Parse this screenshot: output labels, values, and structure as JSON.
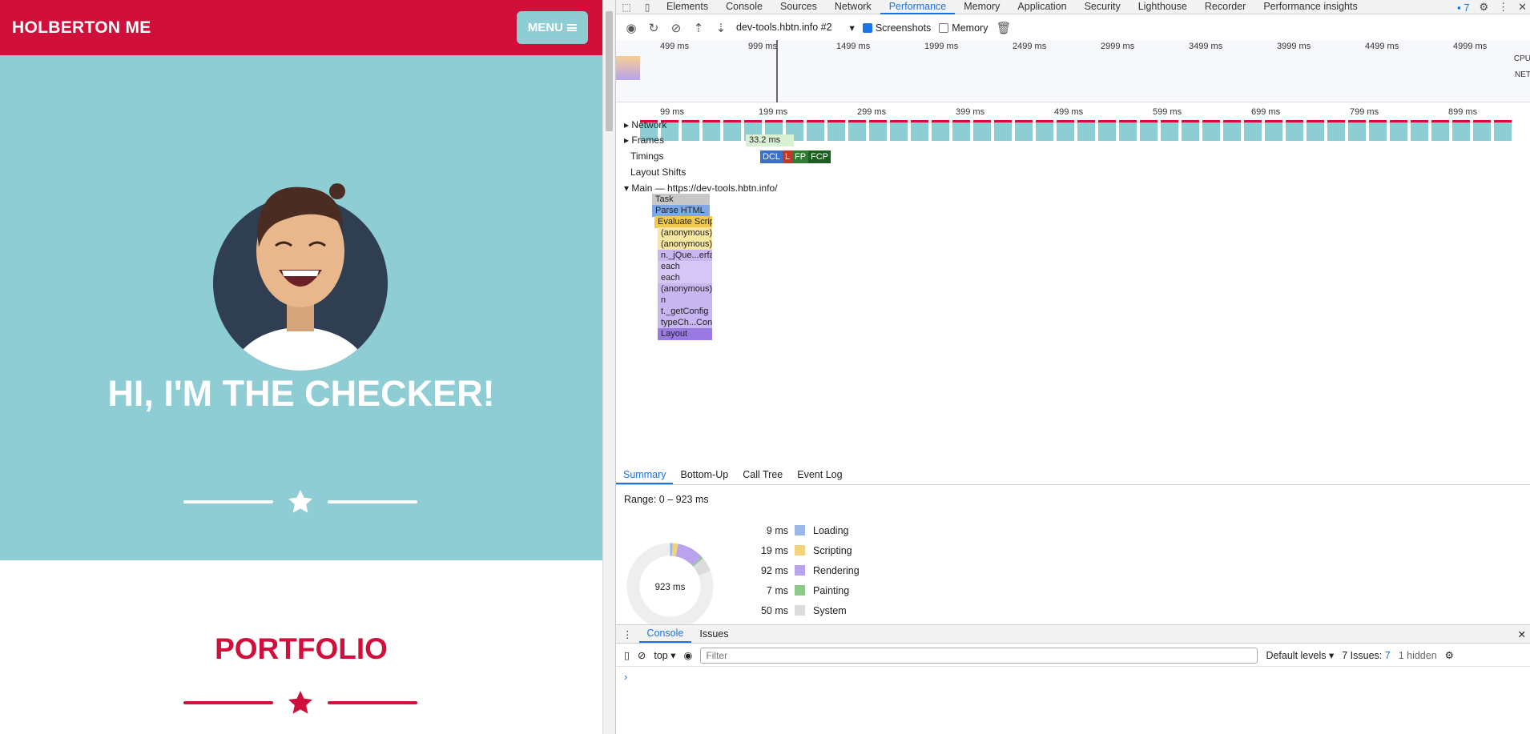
{
  "site": {
    "brand": "HOLBERTON ME",
    "menu_label": "MENU",
    "hero_title": "HI, I'M THE CHECKER!",
    "portfolio_title": "PORTFOLIO",
    "colors": {
      "brand": "#d0103a",
      "hero": "#8ecdd3"
    }
  },
  "devtools": {
    "tabs": [
      "Elements",
      "Console",
      "Sources",
      "Network",
      "Performance",
      "Memory",
      "Application",
      "Security",
      "Lighthouse",
      "Recorder",
      "Performance insights"
    ],
    "active_tab": "Performance",
    "issues_badge": "7",
    "toolbar": {
      "target": "dev-tools.hbtn.info #2",
      "screenshots_label": "Screenshots",
      "memory_label": "Memory"
    },
    "overview_ticks": [
      "499 ms",
      "999 ms",
      "1499 ms",
      "1999 ms",
      "2499 ms",
      "2999 ms",
      "3499 ms",
      "3999 ms",
      "4499 ms",
      "4999 ms"
    ],
    "overview_labels": {
      "cpu": "CPU",
      "net": "NET"
    },
    "main_ticks": [
      "99 ms",
      "199 ms",
      "299 ms",
      "399 ms",
      "499 ms",
      "599 ms",
      "699 ms",
      "799 ms",
      "899 ms"
    ],
    "tracks": {
      "network": "Network",
      "frames": "Frames",
      "frame_time": "33.2 ms",
      "timings": "Timings",
      "layout_shifts": "Layout Shifts",
      "main": "Main — https://dev-tools.hbtn.info/"
    },
    "timing_markers": [
      "DCL",
      "L",
      "FP",
      "FCP"
    ],
    "flame": [
      "Task",
      "Parse HTML",
      "Evaluate Script",
      "(anonymous)",
      "(anonymous)",
      "n._jQue...erface",
      "each",
      "each",
      "(anonymous)",
      "n",
      "t._getConfig",
      "typeCh...Config",
      "Layout"
    ],
    "bottom_tabs": [
      "Summary",
      "Bottom-Up",
      "Call Tree",
      "Event Log"
    ],
    "range": "Range: 0 – 923 ms",
    "total": "923 ms",
    "summary": [
      {
        "ms": "9 ms",
        "label": "Loading",
        "color": "#9ab7e8"
      },
      {
        "ms": "19 ms",
        "label": "Scripting",
        "color": "#f2d37c"
      },
      {
        "ms": "92 ms",
        "label": "Rendering",
        "color": "#b9a3ef"
      },
      {
        "ms": "7 ms",
        "label": "Painting",
        "color": "#8fc98a"
      },
      {
        "ms": "50 ms",
        "label": "System",
        "color": "#dcdcdc"
      }
    ],
    "drawer_tabs": [
      "Console",
      "Issues"
    ],
    "console": {
      "context": "top",
      "filter_placeholder": "Filter",
      "levels": "Default levels",
      "issues": "7 Issues:",
      "issues_count": "7",
      "hidden": "1 hidden",
      "prompt": "›"
    }
  }
}
